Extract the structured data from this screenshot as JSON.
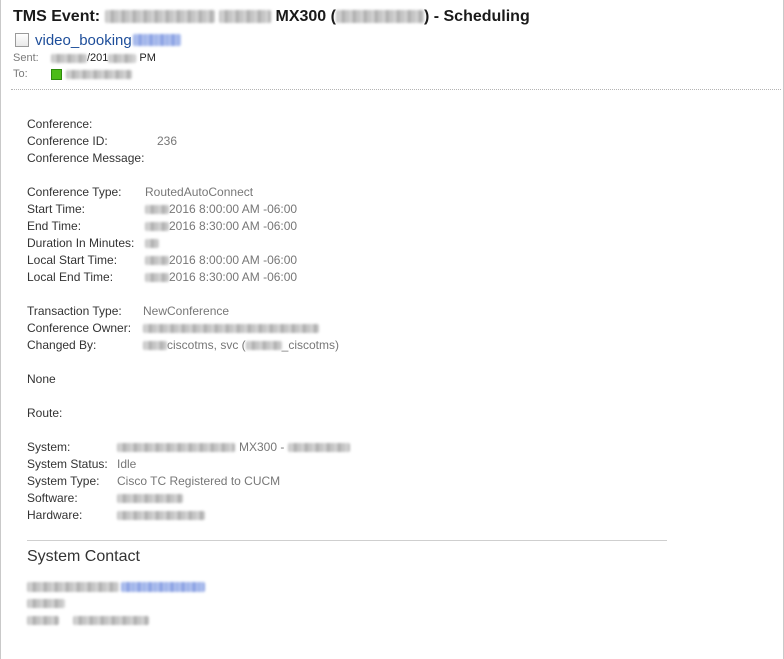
{
  "email": {
    "subject_prefix": "TMS Event:",
    "subject_model": "MX300 (",
    "subject_suffix": ") - Scheduling",
    "from_name": "video_booking",
    "sent_label": "Sent:",
    "sent_year": "/201",
    "sent_suffix": "PM",
    "to_label": "To:"
  },
  "body": {
    "conference_label": "Conference:",
    "conference_id_label": "Conference ID:",
    "conference_id_value": "236",
    "conference_message_label": "Conference Message:",
    "conference_type_label": "Conference Type:",
    "conference_type_value": "RoutedAutoConnect",
    "start_time_label": "Start Time:",
    "start_time_value": "2016 8:00:00 AM -06:00",
    "end_time_label": "End Time:",
    "end_time_value": "2016 8:30:00 AM -06:00",
    "duration_label": "Duration In Minutes:",
    "local_start_label": "Local Start Time:",
    "local_start_value": "2016 8:00:00 AM -06:00",
    "local_end_label": "Local End Time:",
    "local_end_value": "2016 8:30:00 AM -06:00",
    "transaction_type_label": "Transaction Type:",
    "transaction_type_value": "NewConference",
    "conference_owner_label": "Conference Owner:",
    "changed_by_label": "Changed By:",
    "changed_by_value_a": "ciscotms, svc (",
    "changed_by_value_b": "_ciscotms)",
    "none_text": "None",
    "route_label": "Route:",
    "system_label": "System:",
    "system_value": "MX300 -",
    "system_status_label": "System Status:",
    "system_status_value": "Idle",
    "system_type_label": "System Type:",
    "system_type_value": "Cisco TC Registered to CUCM",
    "software_label": "Software:",
    "hardware_label": "Hardware:",
    "system_contact_title": "System Contact"
  }
}
